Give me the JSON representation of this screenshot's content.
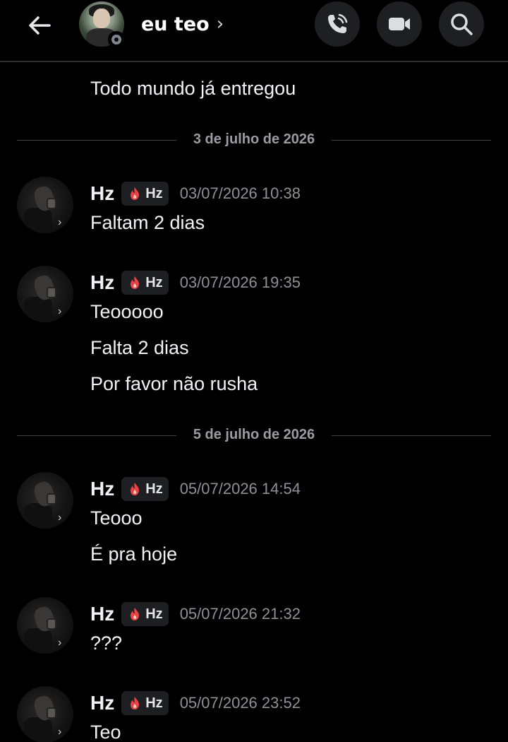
{
  "header": {
    "channel_name": "eu teo",
    "chevron": "›",
    "icons": {
      "back": "arrow-left-icon",
      "call": "phone-icon",
      "video": "video-camera-icon",
      "search": "search-icon"
    },
    "status": "offline"
  },
  "messages": {
    "partial_top": "Todo mundo já entregou",
    "dividers": [
      "3 de julho de 2026",
      "5 de julho de 2026"
    ],
    "groups": [
      {
        "user": "Hz",
        "tag": "Hz",
        "time": "03/07/2026 10:38",
        "lines": [
          "Faltam 2 dias"
        ]
      },
      {
        "user": "Hz",
        "tag": "Hz",
        "time": "03/07/2026 19:35",
        "lines": [
          "Teooooo",
          "Falta 2 dias",
          "Por favor não rusha"
        ]
      },
      {
        "user": "Hz",
        "tag": "Hz",
        "time": "05/07/2026 14:54",
        "lines": [
          "Teooo",
          "É pra hoje"
        ]
      },
      {
        "user": "Hz",
        "tag": "Hz",
        "time": "05/07/2026 21:32",
        "lines": [
          "???"
        ]
      },
      {
        "user": "Hz",
        "tag": "Hz",
        "time": "05/07/2026 23:52",
        "lines": [
          "Teo"
        ]
      }
    ]
  },
  "colors": {
    "background": "#000000",
    "text": "#f2f3f5",
    "muted": "#8e9097",
    "chip": "#1e1f22",
    "flame": "#ed4245"
  }
}
